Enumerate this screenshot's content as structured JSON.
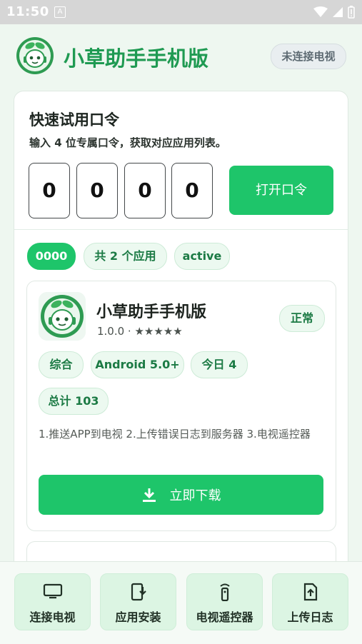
{
  "status_bar": {
    "time": "11:50",
    "notification_glyph": "A"
  },
  "header": {
    "app_title": "小草助手手机版",
    "connection_status": "未连接电视"
  },
  "trial": {
    "title": "快速试用口令",
    "subtitle": "输入 4 位专属口令，获取对应应用列表。",
    "digits": [
      "0",
      "0",
      "0",
      "0"
    ],
    "open_button": "打开口令"
  },
  "result_chips": {
    "code": "0000",
    "count": "共 2 个应用",
    "state": "active"
  },
  "app": {
    "name": "小草助手手机版",
    "meta": "1.0.0 · ★★★★★",
    "status": "正常",
    "tags": [
      "综合",
      "Android 5.0+",
      "今日 4",
      "总计 103"
    ],
    "description": "1.推送APP到电视   2.上传错误日志到服务器   3.电视遥控器",
    "download_button": "立即下载"
  },
  "bottom_nav": [
    {
      "label": "连接电视",
      "icon": "tv-icon"
    },
    {
      "label": "应用安装",
      "icon": "phone-download-icon"
    },
    {
      "label": "电视遥控器",
      "icon": "remote-icon"
    },
    {
      "label": "上传日志",
      "icon": "upload-file-icon"
    }
  ],
  "colors": {
    "accent": "#1ec56a",
    "title_green": "#1f9a52",
    "chip_bg": "#ecf9f0"
  }
}
